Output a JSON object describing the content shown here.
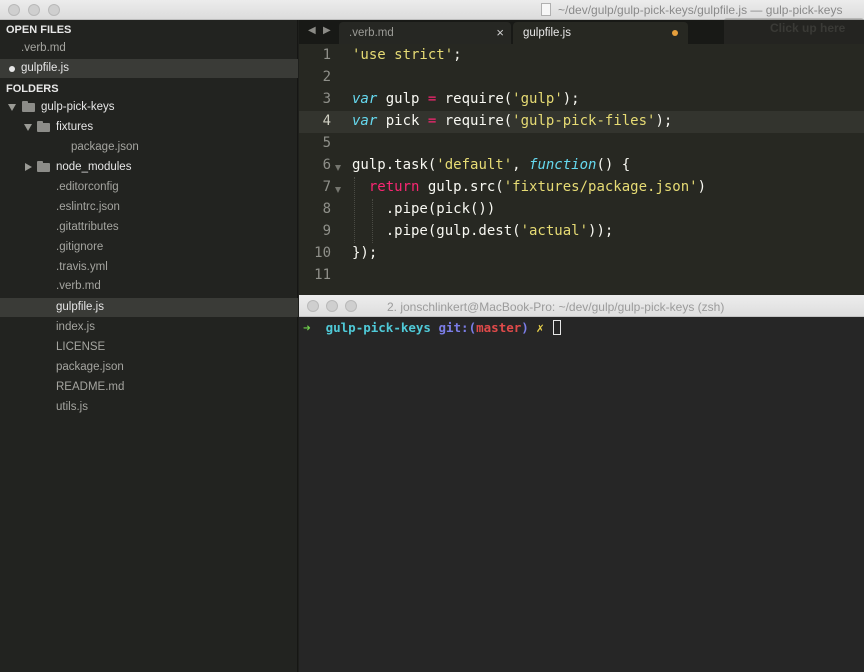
{
  "window": {
    "title": "~/dev/gulp/gulp-pick-keys/gulpfile.js — gulp-pick-keys"
  },
  "sidebar": {
    "open_files_header": "OPEN FILES",
    "open_files": [
      {
        "label": ".verb.md",
        "selected": false
      },
      {
        "label": "gulpfile.js",
        "selected": true
      }
    ],
    "folders_header": "FOLDERS",
    "tree": [
      {
        "label": "gulp-pick-keys",
        "type": "folder-open"
      },
      {
        "label": "fixtures",
        "type": "folder-open"
      },
      {
        "label": "package.json",
        "type": "file"
      },
      {
        "label": "node_modules",
        "type": "folder-closed"
      },
      {
        "label": ".editorconfig",
        "type": "file"
      },
      {
        "label": ".eslintrc.json",
        "type": "file"
      },
      {
        "label": ".gitattributes",
        "type": "file"
      },
      {
        "label": ".gitignore",
        "type": "file"
      },
      {
        "label": ".travis.yml",
        "type": "file"
      },
      {
        "label": ".verb.md",
        "type": "file"
      },
      {
        "label": "gulpfile.js",
        "type": "file",
        "selected": true
      },
      {
        "label": "index.js",
        "type": "file"
      },
      {
        "label": "LICENSE",
        "type": "file"
      },
      {
        "label": "package.json",
        "type": "file"
      },
      {
        "label": "README.md",
        "type": "file"
      },
      {
        "label": "utils.js",
        "type": "file"
      }
    ]
  },
  "tabs": {
    "nav_prev": "◀",
    "nav_next": "▶",
    "items": [
      {
        "label": ".verb.md",
        "close": "×"
      },
      {
        "label": "gulpfile.js"
      }
    ],
    "ghost_hint": "Click up here"
  },
  "editor": {
    "current_line": 4,
    "line_numbers": [
      "1",
      "2",
      "3",
      "4",
      "5",
      "6",
      "7",
      "8",
      "9",
      "10",
      "11"
    ],
    "lines": [
      [
        {
          "t": "'use strict'",
          "c": "str"
        },
        {
          "t": ";",
          "c": "plain"
        }
      ],
      [],
      [
        {
          "t": "var",
          "c": "kw"
        },
        {
          "t": " gulp ",
          "c": "plain"
        },
        {
          "t": "=",
          "c": "op"
        },
        {
          "t": " require(",
          "c": "plain"
        },
        {
          "t": "'gulp'",
          "c": "str"
        },
        {
          "t": ");",
          "c": "plain"
        }
      ],
      [
        {
          "t": "var",
          "c": "kw"
        },
        {
          "t": " pick ",
          "c": "plain"
        },
        {
          "t": "=",
          "c": "op"
        },
        {
          "t": " require(",
          "c": "plain"
        },
        {
          "t": "'gulp-pick-files'",
          "c": "str"
        },
        {
          "t": ");",
          "c": "plain"
        }
      ],
      [],
      [
        {
          "t": "gulp.task(",
          "c": "plain"
        },
        {
          "t": "'default'",
          "c": "str"
        },
        {
          "t": ", ",
          "c": "plain"
        },
        {
          "t": "function",
          "c": "kw"
        },
        {
          "t": "() {",
          "c": "plain"
        }
      ],
      [
        {
          "t": "  ",
          "c": "plain"
        },
        {
          "t": "return",
          "c": "op"
        },
        {
          "t": " gulp.src(",
          "c": "plain"
        },
        {
          "t": "'fixtures/package.json'",
          "c": "str"
        },
        {
          "t": ")",
          "c": "plain"
        }
      ],
      [
        {
          "t": "    .pipe(pick())",
          "c": "plain"
        }
      ],
      [
        {
          "t": "    .pipe(gulp.dest(",
          "c": "plain"
        },
        {
          "t": "'actual'",
          "c": "str"
        },
        {
          "t": "));",
          "c": "plain"
        }
      ],
      [
        {
          "t": "});",
          "c": "plain"
        }
      ],
      []
    ]
  },
  "terminal": {
    "title": "2. jonschlinkert@MacBook-Pro: ~/dev/gulp/gulp-pick-keys (zsh)",
    "prompt_arrow": "➜",
    "prompt_dir": "gulp-pick-keys",
    "prompt_git": "git:(",
    "prompt_branch": "master",
    "prompt_git_close": ")",
    "prompt_dirty": "✗"
  },
  "colors": {
    "editor_bg": "#272822",
    "sidebar_bg": "#222320",
    "string": "#e6db74",
    "keyword": "#66d9ef",
    "operator": "#f92672",
    "modified_dot": "#e69f3c"
  }
}
